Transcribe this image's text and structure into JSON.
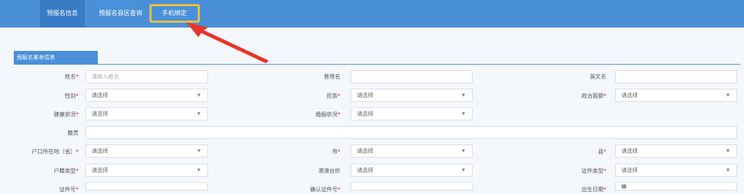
{
  "nav": {
    "tabs": [
      {
        "label": "预报名信息"
      },
      {
        "label": "预报名县区查询"
      },
      {
        "label": "手机绑定"
      }
    ]
  },
  "section": {
    "title": "预报名基本信息"
  },
  "form": {
    "name_label": "姓名",
    "name_placeholder": "请输入姓名",
    "usedname_label": "曾用名",
    "engname_label": "英文名",
    "gender_label": "性别",
    "nation_label": "民族",
    "politics_label": "政治面貌",
    "health_label": "健康状况",
    "marriage_label": "婚姻状况",
    "native_label": "籍贯",
    "hukou_label": "户口所在地（省）",
    "city_label": "市",
    "county_label": "县",
    "hukoutype_label": "户籍类型",
    "hkmt_label": "港澳台侨",
    "idtype_label": "证件类型",
    "idno_label": "证件号",
    "idconfirm_label": "确认证件号",
    "birth_label": "出生日期",
    "select_placeholder": "请选择",
    "required_mark": "*",
    "dropdown_glyph": "▼",
    "calendar_glyph": "▦"
  },
  "colors": {
    "nav": "#4a90d9",
    "highlight": "#f1c232",
    "arrow": "#e8352b"
  }
}
